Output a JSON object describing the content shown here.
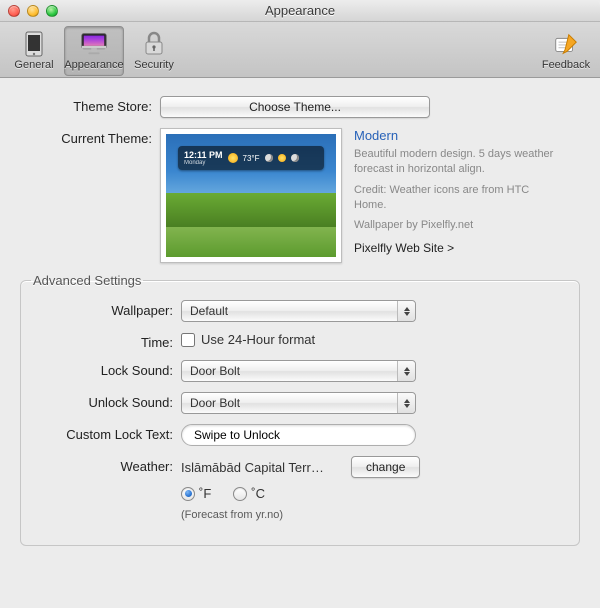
{
  "window": {
    "title": "Appearance"
  },
  "toolbar": {
    "items": [
      {
        "id": "general",
        "label": "General"
      },
      {
        "id": "appearance",
        "label": "Appearance"
      },
      {
        "id": "security",
        "label": "Security"
      }
    ],
    "feedback_label": "Feedback",
    "selected": "appearance"
  },
  "theme_store": {
    "label": "Theme Store:",
    "button": "Choose Theme..."
  },
  "current_theme": {
    "label": "Current Theme:",
    "name": "Modern",
    "description": "Beautiful modern design. 5 days weather forecast in horizontal align.",
    "credit": "Credit: Weather icons are from HTC Home.",
    "wallpaper_credit": "Wallpaper by Pixelfly.net",
    "link_text": "Pixelfly Web Site >",
    "preview": {
      "time": "12:11 PM",
      "day": "Monday",
      "temp": "73°F"
    }
  },
  "advanced": {
    "legend": "Advanced Settings",
    "wallpaper": {
      "label": "Wallpaper:",
      "value": "Default"
    },
    "time": {
      "label": "Time:",
      "checkbox_label": "Use 24-Hour format",
      "checked": false
    },
    "lock_sound": {
      "label": "Lock Sound:",
      "value": "Door Bolt"
    },
    "unlock_sound": {
      "label": "Unlock Sound:",
      "value": "Door Bolt"
    },
    "custom_lock_text": {
      "label": "Custom Lock Text:",
      "value": "Swipe to Unlock"
    },
    "weather": {
      "label": "Weather:",
      "location": "Islāmābād Capital Terr…",
      "change_button": "change",
      "unit_f": "˚F",
      "unit_c": "˚C",
      "unit_selected": "f",
      "forecast_note": "(Forecast from yr.no)"
    }
  }
}
